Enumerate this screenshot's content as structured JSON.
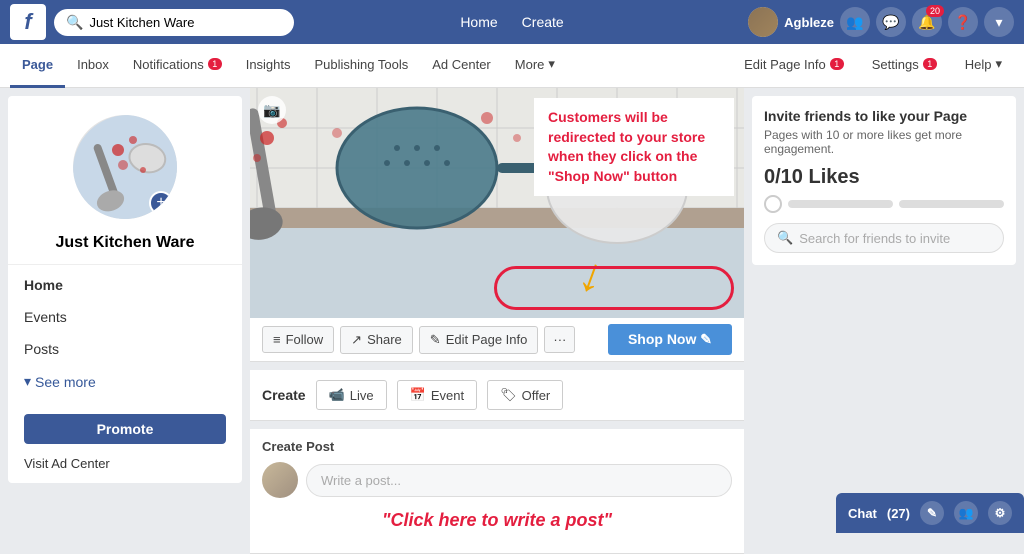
{
  "topbar": {
    "logo": "f",
    "search_placeholder": "Just Kitchen Ware",
    "nav_items": [
      "Home",
      "Create"
    ],
    "username": "Agbleze",
    "notification_count": "20"
  },
  "page_nav": {
    "items": [
      {
        "label": "Page",
        "active": true
      },
      {
        "label": "Inbox"
      },
      {
        "label": "Notifications",
        "badge": "1"
      },
      {
        "label": "Insights"
      },
      {
        "label": "Publishing Tools"
      },
      {
        "label": "Ad Center"
      },
      {
        "label": "More",
        "dropdown": true
      }
    ],
    "right_items": [
      {
        "label": "Edit Page Info",
        "badge": "1"
      },
      {
        "label": "Settings",
        "badge": "1"
      },
      {
        "label": "Help",
        "dropdown": true
      }
    ]
  },
  "sidebar": {
    "page_name": "Just Kitchen Ware",
    "menu_items": [
      "Home",
      "Events",
      "Posts"
    ],
    "see_more_label": "See more",
    "promote_label": "Promote",
    "visit_ad_center_label": "Visit Ad Center"
  },
  "cover": {
    "camera_icon": "📷",
    "callout_text": "Customers will be redirected to your store when they click on the \"Shop Now\" button"
  },
  "action_bar": {
    "follow_label": "Follow",
    "share_label": "Share",
    "edit_page_info_label": "Edit Page Info",
    "more_label": "···",
    "shop_now_label": "Shop Now ✎"
  },
  "create_bar": {
    "create_label": "Create",
    "live_label": "Live",
    "event_label": "Event",
    "offer_label": "Offer"
  },
  "create_post": {
    "label": "Create Post",
    "placeholder": "Write a post...",
    "write_hint": "\"Click here to write a post\""
  },
  "right_sidebar": {
    "invite_title": "Invite friends to like your Page",
    "invite_subtitle": "Pages with 10 or more likes get more engagement.",
    "likes_count": "0/10 Likes",
    "search_placeholder": "Search for friends to invite"
  },
  "chat": {
    "label": "Chat",
    "count": "(27)"
  }
}
